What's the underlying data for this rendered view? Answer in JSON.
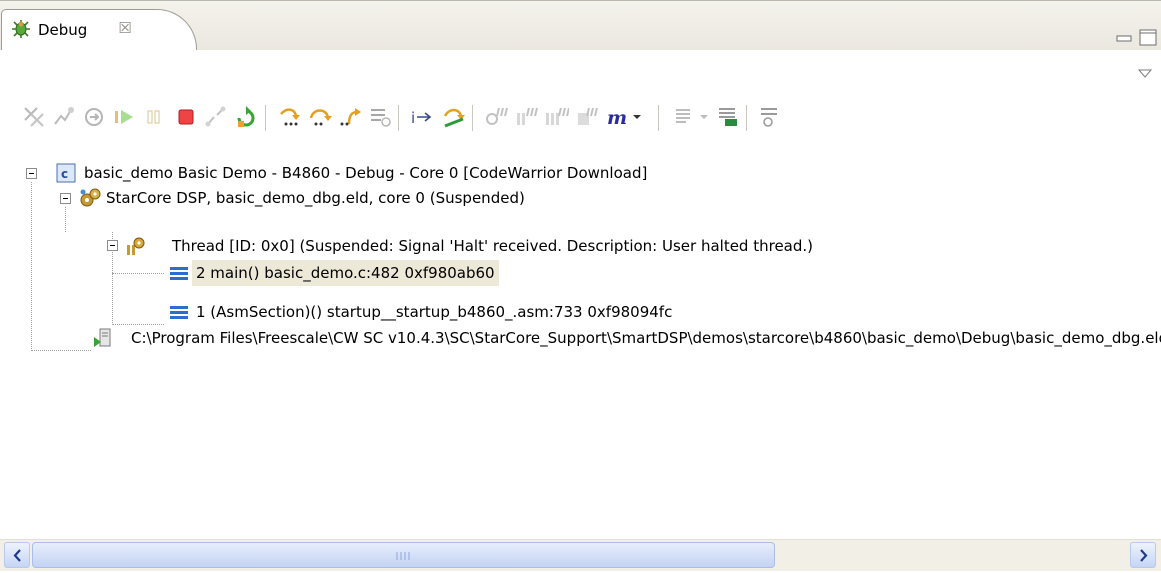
{
  "view": {
    "tab_label": "Debug",
    "tab_icon": "debug-bug-icon",
    "close_glyph": "☒"
  },
  "toolbar_icons": [
    "remove-terminated-icon",
    "connect-icon",
    "reset-icon",
    "resume-icon",
    "suspend-icon",
    "terminate-icon",
    "disconnect-icon",
    "restart-icon",
    "step-into-icon",
    "step-over-icon",
    "step-return-icon",
    "drop-to-frame-icon",
    "instruction-stepping-icon",
    "use-step-filters-icon",
    "multicore-resume-icon",
    "multicore-suspend-icon",
    "multicore-terminate-icon",
    "multicore-restart-icon",
    "memory-m-icon",
    "dropdown-arrow-icon",
    "show-source-icon",
    "show-disassembly-icon",
    "expand-icon"
  ],
  "tree": {
    "launch": "basic_demo Basic Demo - B4860 - Debug - Core 0 [CodeWarrior Download]",
    "target": "StarCore DSP, basic_demo_dbg.eld, core 0 (Suspended)",
    "thread": "Thread [ID: 0x0] (Suspended: Signal 'Halt' received. Description: User halted thread.)",
    "frame1": "2 main() basic_demo.c:482 0xf980ab60",
    "frame2": "1 (AsmSection)() startup__startup_b4860_.asm:733 0xf98094fc",
    "process": "C:\\Program Files\\Freescale\\CW SC v10.4.3\\SC\\StarCore_Support\\SmartDSP\\demos\\starcore\\b4860\\basic_demo\\Debug\\basic_demo_dbg.eld"
  },
  "colors": {
    "selection": "#ece9d8",
    "scroll_blue": "#c5d5f5"
  }
}
